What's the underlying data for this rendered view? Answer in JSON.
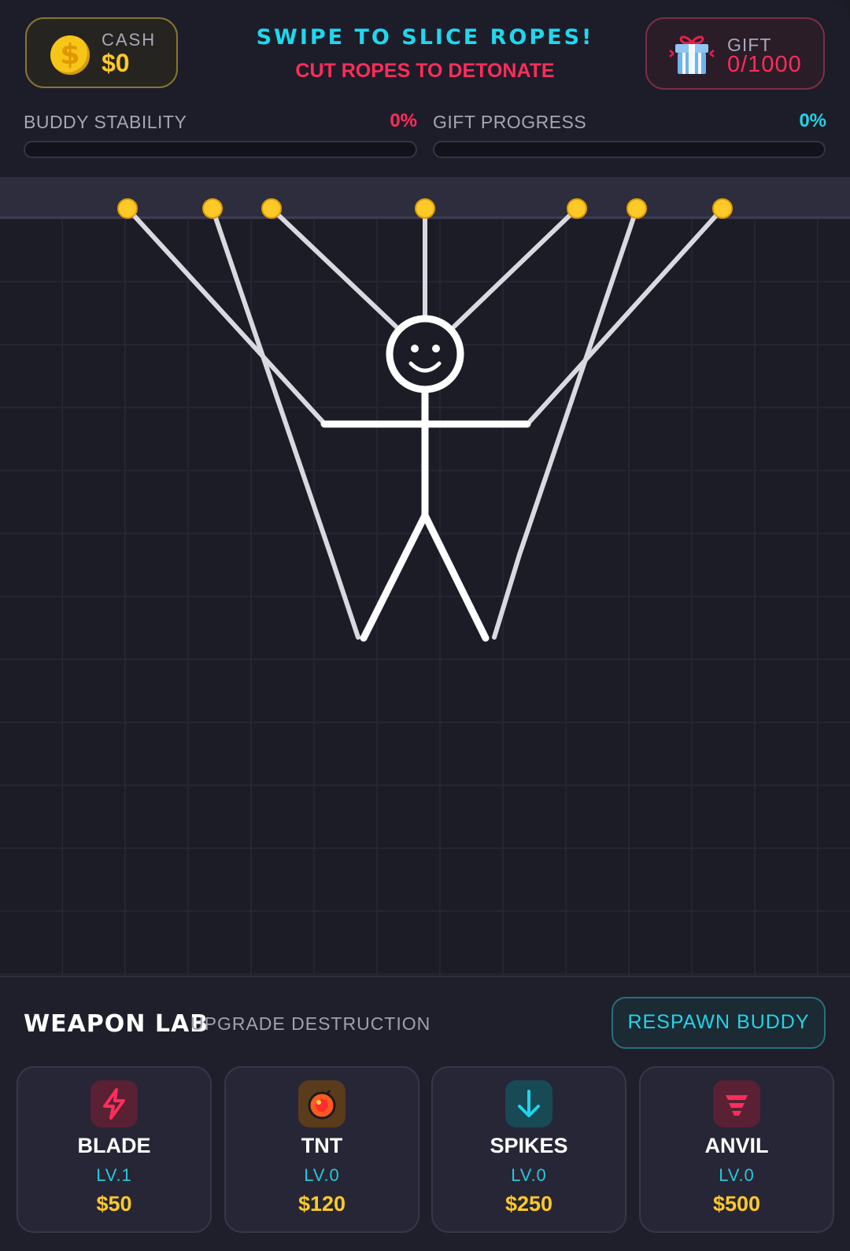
{
  "header": {
    "cash_label": "CASH",
    "cash_value": "$0",
    "coin_symbol": "$",
    "title": "SWIPE TO SLICE ROPES!",
    "subtitle": "CUT ROPES TO DETONATE",
    "gift_label": "GIFT",
    "gift_value": "0/1000"
  },
  "progress": {
    "stability": {
      "label": "BUDDY STABILITY",
      "percent_text": "0%",
      "value": 0,
      "color": "#ff2d5a"
    },
    "gift": {
      "label": "GIFT PROGRESS",
      "percent_text": "0%",
      "value": 0,
      "color": "#22d3e8"
    }
  },
  "game": {
    "anchor_color": "#ffc928",
    "rope_color": "#d9d9e0",
    "buddy_color": "#ffffff",
    "anchor_count": 7
  },
  "panel": {
    "title": "WEAPON LAB",
    "subtitle": "UPGRADE DESTRUCTION",
    "respawn_label": "RESPAWN BUDDY",
    "weapons": [
      {
        "name": "BLADE",
        "level": "LV.1",
        "price": "$50",
        "icon": "lightning-icon",
        "color": "#ff2d5a"
      },
      {
        "name": "TNT",
        "level": "LV.0",
        "price": "$120",
        "icon": "bomb-icon",
        "color": "#ff5a1f"
      },
      {
        "name": "SPIKES",
        "level": "LV.0",
        "price": "$250",
        "icon": "arrow-down-icon",
        "color": "#22d3e8"
      },
      {
        "name": "ANVIL",
        "level": "LV.0",
        "price": "$500",
        "icon": "anvil-icon",
        "color": "#ff2d5a"
      }
    ]
  }
}
